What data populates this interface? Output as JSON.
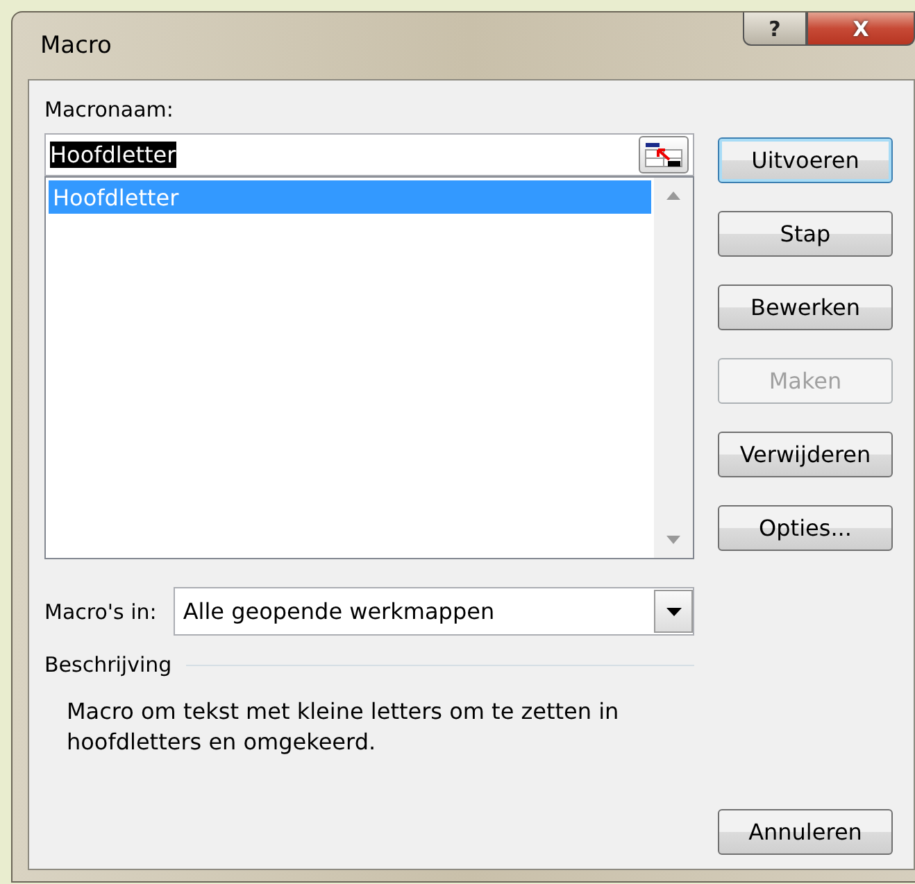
{
  "window": {
    "title": "Macro",
    "help_button": "?",
    "close_button": "X"
  },
  "macro_name": {
    "label": "Macronaam:",
    "value": "Hoofdletter"
  },
  "macro_list": {
    "items": [
      {
        "label": "Hoofdletter",
        "selected": true
      }
    ]
  },
  "macros_in": {
    "label": "Macro's in:",
    "value": "Alle geopende werkmappen"
  },
  "description": {
    "label": "Beschrijving",
    "text": "Macro om tekst met kleine letters om te zetten in hoofdletters en omgekeerd."
  },
  "buttons": [
    {
      "label": "Uitvoeren",
      "default": true,
      "disabled": false
    },
    {
      "label": "Stap",
      "default": false,
      "disabled": false
    },
    {
      "label": "Bewerken",
      "default": false,
      "disabled": false
    },
    {
      "label": "Maken",
      "default": false,
      "disabled": true
    },
    {
      "label": "Verwijderen",
      "default": false,
      "disabled": false
    },
    {
      "label": "Opties...",
      "default": false,
      "disabled": false
    }
  ],
  "cancel_button": "Annuleren"
}
